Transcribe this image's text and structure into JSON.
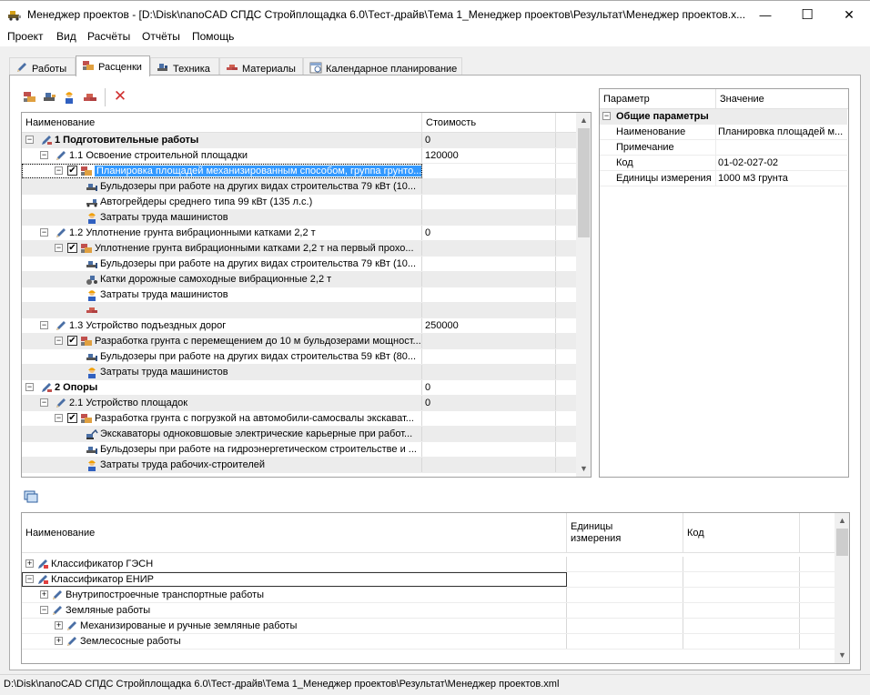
{
  "window": {
    "title": "Менеджер проектов - [D:\\Disk\\nanoCAD СПДС Стройплощадка 6.0\\Тест-драйв\\Тема 1_Менеджер проектов\\Результат\\Менеджер проектов.x...",
    "minimize": "—",
    "maximize": "☐",
    "close": "✕"
  },
  "menu": [
    "Проект",
    "Вид",
    "Расчёты",
    "Отчёты",
    "Помощь"
  ],
  "tabs": [
    {
      "label": "Работы",
      "icon": "pencil-icon"
    },
    {
      "label": "Расценки",
      "icon": "rates-icon",
      "active": true
    },
    {
      "label": "Техника",
      "icon": "machinery-icon"
    },
    {
      "label": "Материалы",
      "icon": "bricks-icon"
    },
    {
      "label": "Календарное планирование",
      "icon": "calendar-icon"
    }
  ],
  "toolbar": {
    "delete": "✕"
  },
  "top_grid": {
    "columns": [
      "Наименование",
      "Стоимость"
    ],
    "rows": [
      {
        "level": 0,
        "expander": "−",
        "icon": "work-section-icon",
        "label": "1 Подготовительные работы",
        "value": "0",
        "bold": true,
        "alt": true
      },
      {
        "level": 1,
        "expander": "−",
        "icon": "work-icon",
        "label": "1.1 Освоение строительной площадки",
        "value": "120000"
      },
      {
        "level": 2,
        "expander": "−",
        "check": true,
        "icon": "rate-icon",
        "label": "Планировка площадей механизированным способом, группа грунто...",
        "value": "",
        "selected": true
      },
      {
        "level": 3,
        "icon": "bulldozer-icon",
        "label": "Бульдозеры при работе на других видах строительства 79 кВт (10...",
        "value": "",
        "alt": true
      },
      {
        "level": 3,
        "icon": "grader-icon",
        "label": "Автогрейдеры среднего типа 99 кВт (135 л.с.)",
        "value": ""
      },
      {
        "level": 3,
        "icon": "worker-icon",
        "label": "Затраты труда машинистов",
        "value": "",
        "alt": true
      },
      {
        "level": 1,
        "expander": "−",
        "icon": "work-icon",
        "label": "1.2 Уплотнение грунта вибрационными катками 2,2 т",
        "value": "0"
      },
      {
        "level": 2,
        "expander": "−",
        "check": true,
        "icon": "rate-icon",
        "label": "Уплотнение грунта вибрационными катками 2,2 т на первый прохо...",
        "value": "",
        "alt": true
      },
      {
        "level": 3,
        "icon": "bulldozer-icon",
        "label": "Бульдозеры при работе на других видах строительства 79 кВт (10...",
        "value": ""
      },
      {
        "level": 3,
        "icon": "roller-icon",
        "label": "Катки дорожные самоходные вибрационные 2,2 т",
        "value": "",
        "alt": true
      },
      {
        "level": 3,
        "icon": "worker-icon",
        "label": "Затраты труда машинистов",
        "value": ""
      },
      {
        "level": 3,
        "icon": "material-icon",
        "label": "",
        "value": "",
        "alt": true
      },
      {
        "level": 1,
        "expander": "−",
        "icon": "work-icon",
        "label": "1.3 Устройство подъездных дорог",
        "value": "250000"
      },
      {
        "level": 2,
        "expander": "−",
        "check": true,
        "icon": "rate-icon",
        "label": "Разработка грунта с перемещением до 10 м бульдозерами мощност...",
        "value": "",
        "alt": true
      },
      {
        "level": 3,
        "icon": "bulldozer-icon",
        "label": "Бульдозеры при работе на других видах строительства 59 кВт (80...",
        "value": ""
      },
      {
        "level": 3,
        "icon": "worker-icon",
        "label": "Затраты труда машинистов",
        "value": "",
        "alt": true
      },
      {
        "level": 0,
        "expander": "−",
        "icon": "work-section-icon",
        "label": "2 Опоры",
        "value": "0",
        "bold": true
      },
      {
        "level": 1,
        "expander": "−",
        "icon": "work-icon",
        "label": "2.1 Устройство площадок",
        "value": "0",
        "alt": true
      },
      {
        "level": 2,
        "expander": "−",
        "check": true,
        "icon": "rate-icon",
        "label": "Разработка грунта с погрузкой на автомобили-самосвалы экскават...",
        "value": ""
      },
      {
        "level": 3,
        "icon": "excavator-icon",
        "label": "Экскаваторы одноковшовые электрические карьерные при работ...",
        "value": "",
        "alt": true
      },
      {
        "level": 3,
        "icon": "bulldozer-icon",
        "label": "Бульдозеры при работе на гидроэнергетическом строительстве и ...",
        "value": ""
      },
      {
        "level": 3,
        "icon": "worker-icon",
        "label": "Затраты труда рабочих-строителей",
        "value": "",
        "alt": true
      }
    ]
  },
  "properties": {
    "columns": [
      "Параметр",
      "Значение"
    ],
    "group": "Общие параметры",
    "expander": "−",
    "rows": [
      {
        "name": "Наименование",
        "value": "Планировка площадей м..."
      },
      {
        "name": "Примечание",
        "value": ""
      },
      {
        "name": "Код",
        "value": "01-02-027-02"
      },
      {
        "name": "Единицы измерения",
        "value": "1000 м3 грунта"
      }
    ]
  },
  "bottom_grid": {
    "columns": [
      "Наименование",
      "Единицы\nизмерения",
      "Код"
    ],
    "rows": [
      {
        "level": 0,
        "expander": "+",
        "icon": "classifier-icon",
        "label": "Классификатор ГЭСН"
      },
      {
        "level": 0,
        "expander": "−",
        "icon": "classifier-icon",
        "label": "Классификатор ЕНИР",
        "focused": true
      },
      {
        "level": 1,
        "expander": "+",
        "icon": "folder-icon",
        "label": "Внутрипостроечные транспортные работы"
      },
      {
        "level": 1,
        "expander": "−",
        "icon": "folder-icon",
        "label": "Земляные работы"
      },
      {
        "level": 2,
        "expander": "+",
        "icon": "folder-icon",
        "label": "Механизированые и ручные земляные работы"
      },
      {
        "level": 2,
        "expander": "+",
        "icon": "folder-icon",
        "label": "Землесосные работы"
      }
    ]
  },
  "status": "D:\\Disk\\nanoCAD СПДС Стройплощадка 6.0\\Тест-драйв\\Тема 1_Менеджер проектов\\Результат\\Менеджер проектов.xml"
}
